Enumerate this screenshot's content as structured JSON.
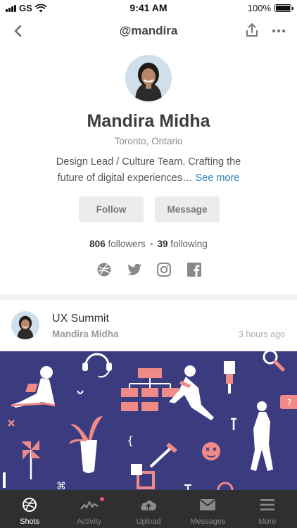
{
  "status_bar": {
    "carrier": "GS",
    "time": "9:41 AM",
    "battery": "100%"
  },
  "header": {
    "title": "@mandira"
  },
  "profile": {
    "name": "Mandira Midha",
    "location": "Toronto, Ontario",
    "bio": "Design Lead / Culture Team. Crafting the future of digital experiences…",
    "see_more": "See more",
    "follow_label": "Follow",
    "message_label": "Message",
    "followers_count": "806",
    "followers_label": "followers",
    "following_count": "39",
    "following_label": "following",
    "socials": [
      "dribbble-icon",
      "twitter-icon",
      "instagram-icon",
      "facebook-icon"
    ]
  },
  "shot": {
    "title": "UX Summit",
    "author": "Mandira Midha",
    "time": "3 hours ago",
    "background": "#3b3b80",
    "accent": "#f08a86"
  },
  "tabbar": {
    "tabs": [
      {
        "label": "Shots",
        "icon": "dribbble-icon",
        "active": true
      },
      {
        "label": "Activity",
        "icon": "activity-icon",
        "active": false
      },
      {
        "label": "Upload",
        "icon": "upload-cloud-icon",
        "active": false
      },
      {
        "label": "Messages",
        "icon": "mail-icon",
        "active": false
      },
      {
        "label": "More",
        "icon": "menu-icon",
        "active": false
      }
    ]
  }
}
